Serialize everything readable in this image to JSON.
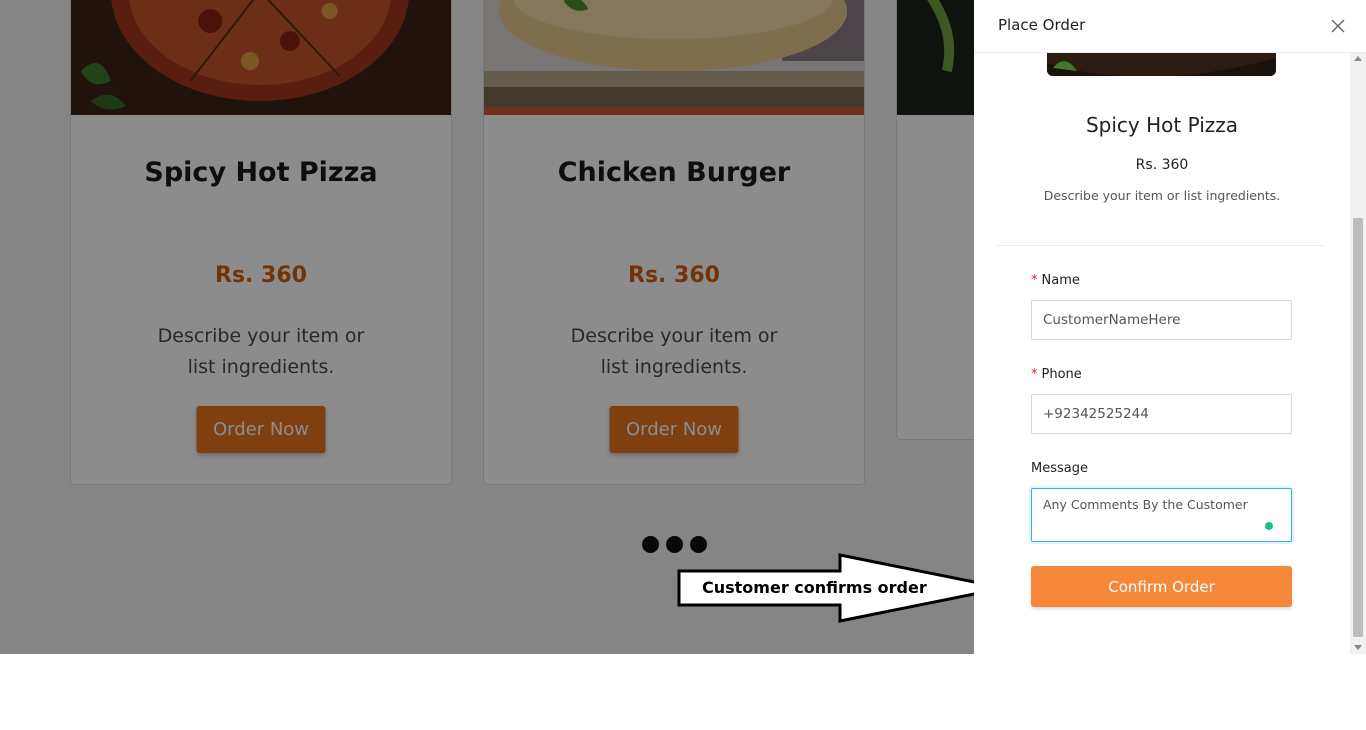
{
  "menu": {
    "cards": [
      {
        "title": "Spicy Hot Pizza",
        "price": "Rs. 360",
        "description": "Describe your item or list ingredients.",
        "button": "Order Now"
      },
      {
        "title": "Chicken Burger",
        "price": "Rs. 360",
        "description": "Describe your item or list ingredients.",
        "button": "Order Now"
      }
    ]
  },
  "drawer": {
    "title": "Place Order",
    "item": {
      "name": "Spicy Hot Pizza",
      "price": "Rs. 360",
      "description": "Describe your item or list ingredients."
    },
    "form": {
      "name_label": "Name",
      "name_value": "CustomerNameHere",
      "phone_label": "Phone",
      "phone_value": "+92342525244",
      "message_label": "Message",
      "message_value": "Any Comments By the Customer",
      "required_mark": "*",
      "submit_label": "Confirm Order"
    }
  },
  "annotation": {
    "text": "Customer confirms order"
  },
  "colors": {
    "accent": "#e8741c",
    "confirm": "#f5883a",
    "price": "#cc5f12",
    "focus": "#34b5e0",
    "required": "#e0282e"
  },
  "icons": {
    "close": "close-icon",
    "carousel": "carousel-dots-icon"
  }
}
